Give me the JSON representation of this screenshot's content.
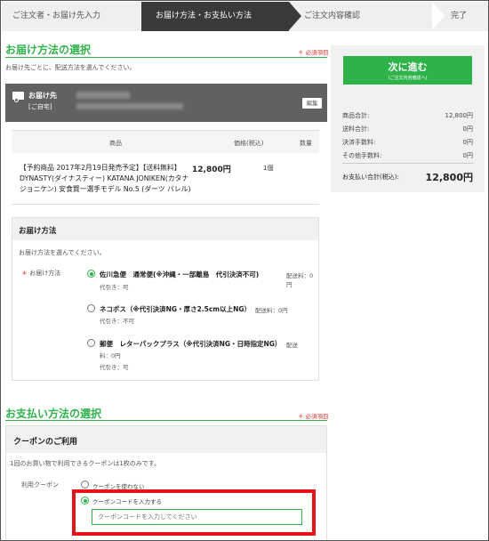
{
  "steps": [
    "ご注文者・お届け先入力",
    "お届け方法・お支払い方法",
    "ご注文内容確認",
    "完了"
  ],
  "delivery_section": {
    "title": "お届け方法の選択",
    "required": "＊ 必須項目",
    "note": "お届け先ごとに、配送方法を選んでください。",
    "destination_label": "お届け先",
    "destination_sub": "[ご自宅]",
    "edit_label": "編集"
  },
  "product_table": {
    "headers": {
      "name": "商品",
      "price": "価格(税込)",
      "qty": "数量"
    },
    "item": {
      "name": "【予約商品 2017年2月19日発売予定】【送料無料】DYNASTY(ダイナスティー) KATANA JONIKEN(カタナ ジョニケン) 安食賢一選手モデル No.5 (ダーツ バレル)",
      "price": "12,800円",
      "qty": "1個"
    }
  },
  "shipping": {
    "title": "お届け方法",
    "note": "お届け方法を選んでください。",
    "field_label": "お届け方法",
    "options": [
      {
        "name": "佐川急便　通常便(※沖縄・一部離島　代引決済不可)",
        "fee": "配送料：0円",
        "cod": "代引き：可"
      },
      {
        "name": "ネコポス（※代引決済NG・厚さ2.5cm以上NG）",
        "fee": "配送料：0円",
        "cod": "代引き：不可"
      },
      {
        "name": "郵便　レターパックプラス（※代引決済NG・日時指定NG）",
        "fee": "配送",
        "fee2": "料：0円",
        "cod": "代引き：可"
      }
    ]
  },
  "payment_section": {
    "title": "お支払い方法の選択",
    "required": "＊ 必須項目"
  },
  "coupon": {
    "title": "クーポンのご利用",
    "note": "1回のお買い物で利用できるクーポンは1枚のみです。",
    "field_label": "利用クーポン",
    "option_none": "クーポンを使わない",
    "option_code": "クーポンコードを入力する",
    "placeholder": "クーポンコードを入力してください"
  },
  "summary": {
    "next_button": "次に進む",
    "next_button_sub": "(ご注文内容確認へ)",
    "rows": [
      {
        "label": "商品合計:",
        "value": "12,800円"
      },
      {
        "label": "送料合計:",
        "value": "0円"
      },
      {
        "label": "決済手数料:",
        "value": "0円"
      },
      {
        "label": "その他手数料:",
        "value": "0円"
      }
    ],
    "total_label": "お支払い合計(税込):",
    "total_value": "12,800円"
  },
  "colors": {
    "accent": "#2eb34a",
    "required": "#e0322c",
    "highlight": "#e5141a"
  }
}
